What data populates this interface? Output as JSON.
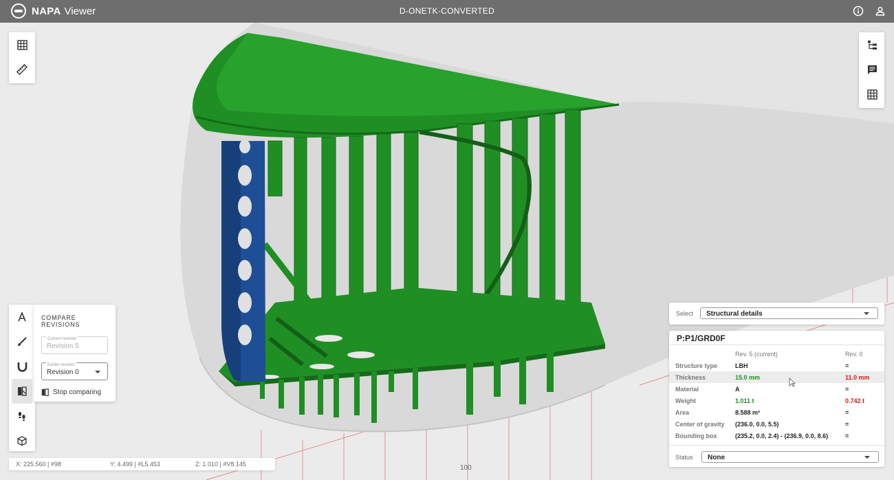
{
  "app": {
    "brand": "NAPA",
    "brand_sub": "Viewer",
    "document_title": "D-ONETK-CONVERTED"
  },
  "header_icons": [
    "info-icon",
    "user-icon"
  ],
  "left_toolbar_top": [
    "table-grid-icon",
    "ruler-icon"
  ],
  "right_toolbar": [
    "tree-structure-icon",
    "comment-icon",
    "table-grid-icon"
  ],
  "left_toolbar_bottom": [
    "text-tool-icon",
    "brush-icon",
    "magnet-icon",
    "compare-revisions-icon",
    "footsteps-icon",
    "cube-icon"
  ],
  "compare": {
    "title": "COMPARE REVISIONS",
    "current_label": "Current revision",
    "current_value": "Revision 5",
    "earlier_label": "Earlier revision",
    "earlier_value": "Revision 0",
    "stop_label": "Stop comparing"
  },
  "coords": {
    "x": "X: 225.560 | #98",
    "y": "Y: 4.499 | #L5.453",
    "z": "Z: 1.010 | #V8.145"
  },
  "axis_tick": "100",
  "select": {
    "label": "Select",
    "value": "Structural details"
  },
  "details": {
    "title": "P:P1/GRD0F",
    "col_current": "Rev. 5 (current)",
    "col_earlier": "Rev. 0",
    "rows": [
      {
        "name": "Structure type",
        "current": "LBH",
        "earlier": "=",
        "changed": false
      },
      {
        "name": "Thickness",
        "current": "15.0 mm",
        "earlier": "11.0 mm",
        "changed": true
      },
      {
        "name": "Material",
        "current": "A",
        "earlier": "=",
        "changed": false
      },
      {
        "name": "Weight",
        "current": "1.011 t",
        "earlier": "0.742 t",
        "changed": true
      },
      {
        "name": "Area",
        "current": "8.588 m²",
        "earlier": "=",
        "changed": false
      },
      {
        "name": "Center of gravity",
        "current": "(236.0, 0.0, 5.5)",
        "earlier": "=",
        "changed": false
      },
      {
        "name": "Bounding box",
        "current": "(235.2, 0.0, 2.4) - (236.9, 0.0, 8.6)",
        "earlier": "=",
        "changed": false
      }
    ],
    "status_label": "Status",
    "status_value": "None"
  },
  "colors": {
    "topbar": "#6e6e6e",
    "structure_green": "#1f8f24",
    "structure_blue": "#1e4f96",
    "hull_grey": "#d8d8d8",
    "increase": "#1a8f1a",
    "decrease": "#d11a1a",
    "grid_red": "#e04040"
  }
}
